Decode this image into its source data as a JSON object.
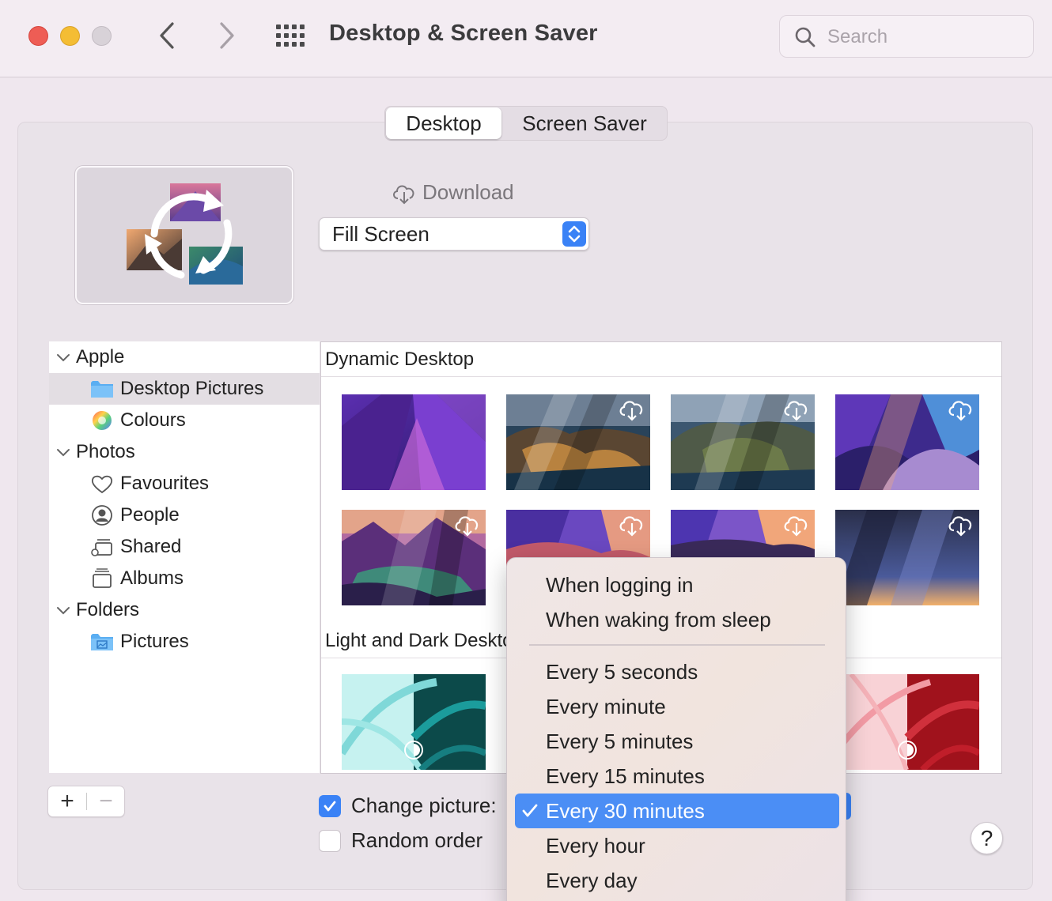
{
  "window": {
    "title": "Desktop & Screen Saver",
    "search_placeholder": "Search"
  },
  "tabs": [
    {
      "label": "Desktop",
      "selected": true
    },
    {
      "label": "Screen Saver",
      "selected": false
    }
  ],
  "download_label": "Download",
  "fill_mode": "Fill Screen",
  "sidebar": {
    "groups": [
      {
        "label": "Apple",
        "items": [
          {
            "label": "Desktop Pictures",
            "icon": "folder-icon",
            "selected": true
          },
          {
            "label": "Colours",
            "icon": "color-wheel-icon"
          }
        ]
      },
      {
        "label": "Photos",
        "items": [
          {
            "label": "Favourites",
            "icon": "heart-icon"
          },
          {
            "label": "People",
            "icon": "person-icon"
          },
          {
            "label": "Shared",
            "icon": "shared-icon"
          },
          {
            "label": "Albums",
            "icon": "albums-icon"
          }
        ]
      },
      {
        "label": "Folders",
        "items": [
          {
            "label": "Pictures",
            "icon": "pictures-folder-icon"
          }
        ]
      }
    ]
  },
  "buttons": {
    "add": "+",
    "remove": "−",
    "help": "?"
  },
  "gallery": {
    "sections": [
      {
        "title": "Dynamic Desktop"
      },
      {
        "title": "Light and Dark Desktop"
      }
    ]
  },
  "options": {
    "change_picture": {
      "label": "Change picture:",
      "checked": true
    },
    "random_order": {
      "label": "Random order",
      "checked": false
    }
  },
  "menu": {
    "items": [
      "When logging in",
      "When waking from sleep",
      "Every 5 seconds",
      "Every minute",
      "Every 5 minutes",
      "Every 15 minutes",
      "Every 30 minutes",
      "Every hour",
      "Every day"
    ],
    "selected": "Every 30 minutes"
  },
  "colors": {
    "accent": "#3a82f6",
    "menu_highlight": "#4b8ef5"
  }
}
